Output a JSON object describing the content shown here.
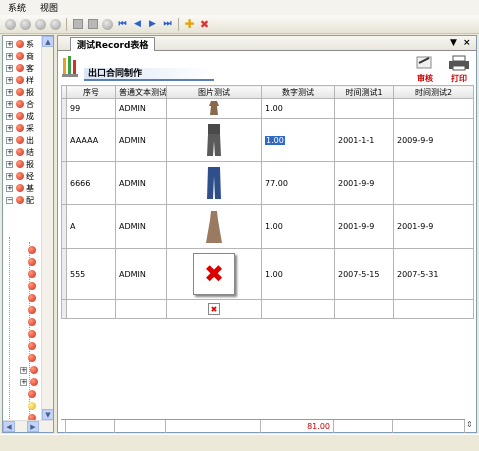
{
  "menu": {
    "items": [
      "系统",
      "视图"
    ]
  },
  "sidebar": {
    "items": [
      {
        "label": "系",
        "expand": "+"
      },
      {
        "label": "商",
        "expand": "+"
      },
      {
        "label": "客",
        "expand": "+"
      },
      {
        "label": "样",
        "expand": "+"
      },
      {
        "label": "报",
        "expand": "+"
      },
      {
        "label": "合",
        "expand": "+"
      },
      {
        "label": "成",
        "expand": "+"
      },
      {
        "label": "采",
        "expand": "+"
      },
      {
        "label": "出",
        "expand": "+"
      },
      {
        "label": "结",
        "expand": "+"
      },
      {
        "label": "报",
        "expand": "+"
      },
      {
        "label": "经",
        "expand": "+"
      },
      {
        "label": "基",
        "expand": "+"
      },
      {
        "label": "配",
        "expand": "−"
      }
    ]
  },
  "tab": {
    "title": "测试Record表格",
    "pin": "▼",
    "close": "×"
  },
  "form": {
    "title": "出口合同制作",
    "audit_label": "审核",
    "print_label": "打印"
  },
  "table": {
    "headers": [
      "序号",
      "普通文本测试",
      "图片测试",
      "数字测试",
      "时间测试1",
      "时间测试2"
    ],
    "rows": [
      {
        "no": "99",
        "text": "ADMIN",
        "num": "1.00",
        "t1": "",
        "t2": ""
      },
      {
        "no": "AAAAA",
        "text": "ADMIN",
        "num": "1.00",
        "t1": "2001-1-1",
        "t2": "2009-9-9"
      },
      {
        "no": "6666",
        "text": "ADMIN",
        "num": "77.00",
        "t1": "2001-9-9",
        "t2": ""
      },
      {
        "no": "A",
        "text": "ADMIN",
        "num": "1.00",
        "t1": "2001-9-9",
        "t2": "2001-9-9"
      },
      {
        "no": "555",
        "text": "ADMIN",
        "num": "1.00",
        "t1": "2007-5-15",
        "t2": "2007-5-31"
      },
      {
        "no": "",
        "text": "",
        "num": "",
        "t1": "",
        "t2": ""
      }
    ],
    "total": "81.00"
  },
  "colors": {
    "accent": "#316ac5",
    "total": "#cc0000"
  }
}
